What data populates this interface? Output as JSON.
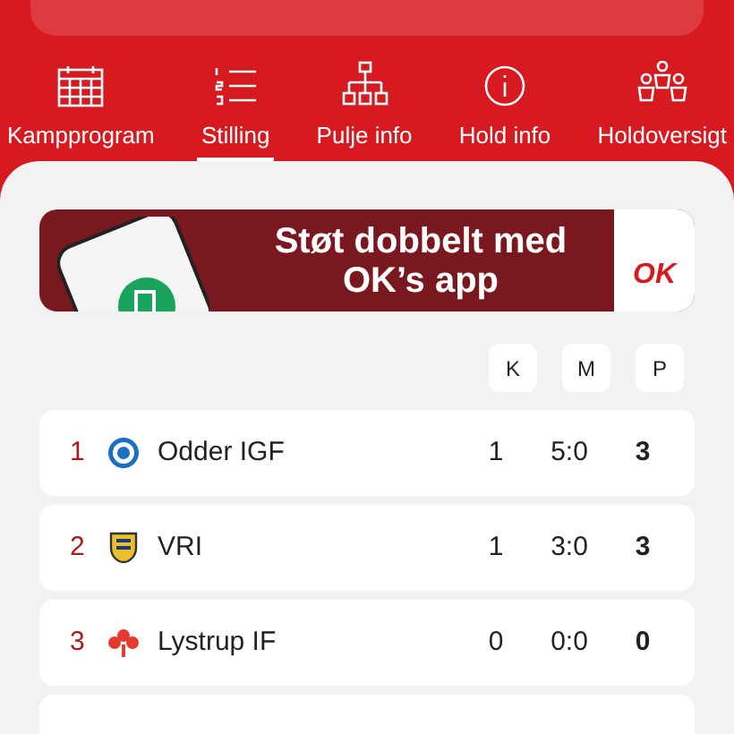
{
  "tabs": [
    {
      "kind": "calendar",
      "label": "Kampprogram",
      "selected": false
    },
    {
      "kind": "list",
      "label": "Stilling",
      "selected": true
    },
    {
      "kind": "tree",
      "label": "Pulje info",
      "selected": false
    },
    {
      "kind": "info",
      "label": "Hold info",
      "selected": false
    },
    {
      "kind": "people",
      "label": "Holdoversigt",
      "selected": false
    }
  ],
  "banner": {
    "headline": "Støt dobbelt med OK’s app",
    "logo": "OK"
  },
  "table": {
    "columns": [
      "K",
      "M",
      "P"
    ],
    "rows": [
      {
        "rank": "1",
        "team": "Odder IGF",
        "kind": "ball",
        "k": "1",
        "m": "5:0",
        "p": "3"
      },
      {
        "rank": "2",
        "team": "VRI",
        "kind": "shield",
        "k": "1",
        "m": "3:0",
        "p": "3"
      },
      {
        "rank": "3",
        "team": "Lystrup IF",
        "kind": "clover",
        "k": "0",
        "m": "0:0",
        "p": "0"
      }
    ]
  }
}
